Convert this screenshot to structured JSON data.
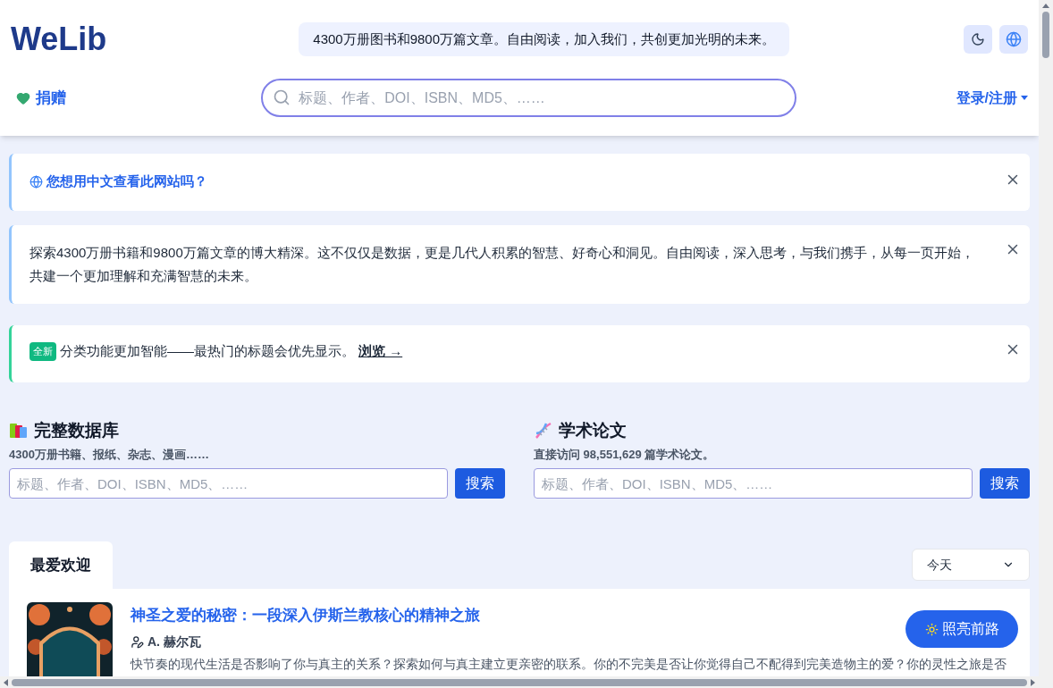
{
  "header": {
    "logo": "WeLib",
    "banner": "4300万册图书和9800万篇文章。自由阅读，加入我们，共创更加光明的未来。",
    "donate": "捐赠",
    "search": {
      "placeholder": "标题、作者、DOI、ISBN、MD5、……"
    },
    "login": "登录/注册"
  },
  "alerts": [
    {
      "kind": "language",
      "color": "#93c5fd",
      "text": "您想用中文查看此网站吗？"
    },
    {
      "kind": "info",
      "color": "#93c5fd",
      "text": "探索4300万册书籍和9800万篇文章的博大精深。这不仅仅是数据，更是几代人积累的智慧、好奇心和洞见。自由阅读，深入思考，与我们携手，从每一页开始，共建一个更加理解和充满智慧的未来。"
    },
    {
      "kind": "news",
      "color": "#34d399",
      "badge": "全新",
      "text": "分类功能更加智能——最热门的标题会优先显示。",
      "link": "浏览 →"
    }
  ],
  "sections": [
    {
      "kind": "books",
      "title": "完整数据库",
      "subtitle": "4300万册书籍、报纸、杂志、漫画……",
      "placeholder": "标题、作者、DOI、ISBN、MD5、……",
      "button": "搜索"
    },
    {
      "kind": "papers",
      "title": "学术论文",
      "subtitle": "直接访问 98,551,629 篇学术论文。",
      "placeholder": "标题、作者、DOI、ISBN、MD5、……",
      "button": "搜索"
    }
  ],
  "tabs": [
    {
      "label": "最爱欢迎",
      "selected": true
    }
  ],
  "period": {
    "value": "今天"
  },
  "books": [
    {
      "title": "神圣之爱的秘密：一段深入伊斯兰教核心的精神之旅",
      "author": "A. 赫尔瓦",
      "description": "快节奏的现代生活是否影响了你与真主的关系？探索如何与真主建立更亲密的联系。你的不完美是否让你觉得自己不配得到完美造物主的爱？你的灵性之旅是否"
    }
  ],
  "fab": {
    "label": "照亮前路"
  }
}
